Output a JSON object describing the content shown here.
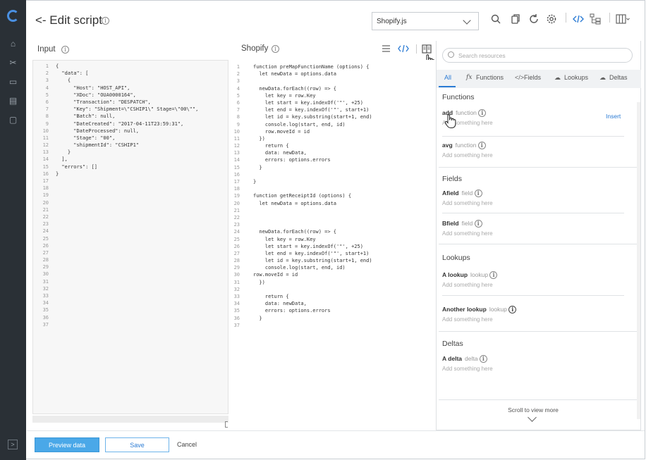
{
  "header": {
    "title": "<- Edit script",
    "script_select": "Shopify.js"
  },
  "input_panel": {
    "title": "Input",
    "line_numbers": [
      "1",
      "2",
      "3",
      "4",
      "5",
      "6",
      "7",
      "8",
      "9",
      "10",
      "11",
      "12",
      "13",
      "14",
      "15",
      "16",
      "17",
      "18",
      "19",
      "20",
      "21",
      "22",
      "23",
      "24",
      "25",
      "26",
      "27",
      "28",
      "29",
      "30",
      "31",
      "32",
      "33",
      "34",
      "35",
      "36",
      "37"
    ],
    "code_lines": [
      "{",
      "  \"data\": [",
      "    {",
      "      \"Host\": \"HOST_API\",",
      "      \"XDoc\": \"OUA0000164\",",
      "      \"Transaction\": \"DESPATCH\",",
      "      \"Key\": \"Shipment=\\\"CSHIP1\\\" Stage=\\\"00\\\"\",",
      "      \"Batch\": null,",
      "      \"DateCreated\": \"2017-04-11T23:59:31\",",
      "      \"DateProcessed\": null,",
      "      \"Stage\": \"00\",",
      "      \"shipmentId\": \"CSHIP1\"",
      "    }",
      "  ],",
      "  \"errors\": []",
      "}"
    ]
  },
  "script_panel": {
    "title": "Shopify",
    "code_lines": [
      "function preMapFunctionName (options) {",
      "  let newData = options.data",
      "",
      "  newData.forEach((row) => {",
      "    let key = row.Key",
      "    let start = key.indexOf('\"', +25)",
      "    let end = key.indexOf('\"', start+1)",
      "    let id = key.substring(start+1, end)",
      "    console.log(start, end, id)",
      "    row.moveId = id",
      "  })",
      "    return {",
      "    data: newData,",
      "    errors: options.errors",
      "  }",
      "",
      "}",
      "",
      "function getReceiptId (options) {",
      "  let newData = options.data",
      "",
      "",
      "",
      "  newData.forEach((row) => {",
      "    let key = row.Key",
      "    let start = key.indexOf('\"', +25)",
      "    let end = key.indexOf('\"', start+1)",
      "    let id = key.substring(start+1, end)",
      "    console.log(start, end, id)",
      "row.moveId = id",
      "  })",
      "",
      "    return {",
      "    data: newData,",
      "    errors: options.errors",
      "  }",
      ""
    ]
  },
  "resources": {
    "search_placeholder": "Search resources",
    "tabs": {
      "all": "All",
      "functions": "Functions",
      "fields": "Fields",
      "lookups": "Lookups",
      "deltas": "Deltas"
    },
    "sections": {
      "functions": {
        "title": "Functions",
        "items": [
          {
            "name": "add",
            "type": "function",
            "desc": "Add something here"
          },
          {
            "name": "avg",
            "type": "function",
            "desc": "Add something here"
          }
        ]
      },
      "fields": {
        "title": "Fields",
        "items": [
          {
            "name": "Afield",
            "type": "field",
            "desc": "Add something here"
          },
          {
            "name": "Bfield",
            "type": "field",
            "desc": "Add something here"
          }
        ]
      },
      "lookups": {
        "title": "Lookups",
        "items": [
          {
            "name": "A lookup",
            "type": "lookup",
            "desc": "Add something here"
          },
          {
            "name": "Another lookup",
            "type": "lookup",
            "desc": "Add something here"
          }
        ]
      },
      "deltas": {
        "title": "Deltas",
        "items": [
          {
            "name": "A delta",
            "type": "delta",
            "desc": "Add something here"
          }
        ]
      }
    },
    "insert_label": "Insert",
    "scroll_hint": "Scroll to view more"
  },
  "footer": {
    "preview": "Preview data",
    "save": "Save",
    "cancel": "Cancel"
  },
  "colors": {
    "accent": "#2b7bd4",
    "rail": "#2a3036",
    "preview_button": "#4aa8e8"
  }
}
